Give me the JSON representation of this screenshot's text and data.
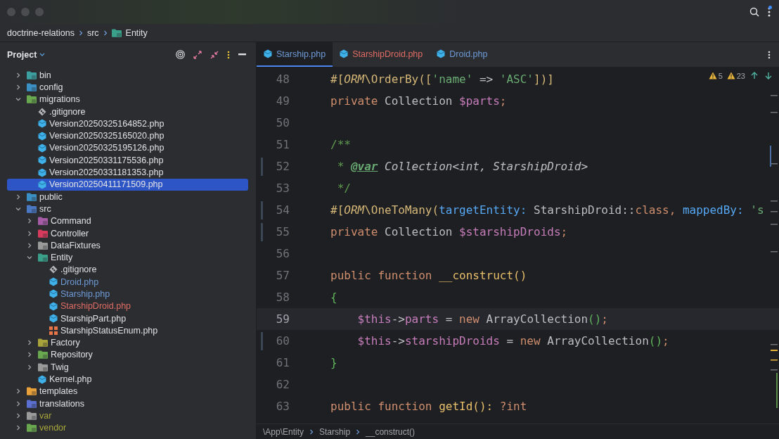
{
  "breadcrumbs": [
    {
      "label": "doctrine-relations",
      "kind": "text"
    },
    {
      "label": "src",
      "kind": "text"
    },
    {
      "label": "Entity",
      "kind": "folder"
    }
  ],
  "project_panel": {
    "title": "Project",
    "tree": [
      {
        "label": "bin",
        "kind": "folder",
        "color": "#3d9ea0",
        "expanded": false,
        "selected": false
      },
      {
        "label": "config",
        "kind": "folder",
        "color": "#3a8fc4",
        "expanded": false,
        "selected": false
      },
      {
        "label": "migrations",
        "kind": "folder",
        "color": "#6aa84f",
        "expanded": true,
        "selected": false,
        "children": [
          {
            "label": ".gitignore",
            "kind": "gitignore",
            "selected": false
          },
          {
            "label": "Version20250325164852.php",
            "kind": "php",
            "selected": false
          },
          {
            "label": "Version20250325165020.php",
            "kind": "php",
            "selected": false
          },
          {
            "label": "Version20250325195126.php",
            "kind": "php",
            "selected": false
          },
          {
            "label": "Version20250331175536.php",
            "kind": "php",
            "selected": false
          },
          {
            "label": "Version20250331181353.php",
            "kind": "php",
            "selected": false
          },
          {
            "label": "Version20250411171509.php",
            "kind": "php",
            "selected": true
          }
        ]
      },
      {
        "label": "public",
        "kind": "folder",
        "color": "#3a8fc4",
        "expanded": false,
        "selected": false
      },
      {
        "label": "src",
        "kind": "folder",
        "color": "#4a78c2",
        "expanded": true,
        "selected": false,
        "children": [
          {
            "label": "Command",
            "kind": "folder",
            "color": "#a55ba6",
            "expanded": false,
            "selected": false
          },
          {
            "label": "Controller",
            "kind": "folder",
            "color": "#d63a5c",
            "expanded": false,
            "selected": false
          },
          {
            "label": "DataFixtures",
            "kind": "folder",
            "color": "#9a9a9a",
            "expanded": false,
            "selected": false
          },
          {
            "label": "Entity",
            "kind": "folder",
            "color": "#3aa08a",
            "expanded": true,
            "selected": false,
            "children": [
              {
                "label": ".gitignore",
                "kind": "gitignore",
                "selected": false
              },
              {
                "label": "Droid.php",
                "kind": "php",
                "selected": false,
                "modified": true
              },
              {
                "label": "Starship.php",
                "kind": "php",
                "selected": false,
                "modified": true
              },
              {
                "label": "StarshipDroid.php",
                "kind": "php",
                "selected": false,
                "added": true
              },
              {
                "label": "StarshipPart.php",
                "kind": "php",
                "selected": false
              },
              {
                "label": "StarshipStatusEnum.php",
                "kind": "enum",
                "selected": false
              }
            ]
          },
          {
            "label": "Factory",
            "kind": "folder",
            "color": "#a8a23a",
            "expanded": false,
            "selected": false
          },
          {
            "label": "Repository",
            "kind": "folder",
            "color": "#6aa84f",
            "expanded": false,
            "selected": false
          },
          {
            "label": "Twig",
            "kind": "folder",
            "color": "#9a9a9a",
            "expanded": false,
            "selected": false
          },
          {
            "label": "Kernel.php",
            "kind": "php",
            "selected": false
          }
        ]
      },
      {
        "label": "templates",
        "kind": "folder",
        "color": "#e8a03a",
        "expanded": false,
        "selected": false
      },
      {
        "label": "translations",
        "kind": "folder",
        "color": "#5a6fd0",
        "expanded": false,
        "selected": false
      },
      {
        "label": "var",
        "kind": "folder",
        "color": "#9a9a9a",
        "expanded": false,
        "selected": false,
        "ignored": true
      },
      {
        "label": "vendor",
        "kind": "folder",
        "color": "#6aa84f",
        "expanded": false,
        "selected": false,
        "ignored": true
      }
    ]
  },
  "editor": {
    "tabs": [
      {
        "label": "Starship.php",
        "selected": true,
        "modified": true,
        "added": false
      },
      {
        "label": "StarshipDroid.php",
        "selected": false,
        "modified": false,
        "added": true
      },
      {
        "label": "Droid.php",
        "selected": false,
        "modified": true,
        "added": false
      }
    ],
    "inspections": {
      "warnings": "5",
      "weak_warnings": "23"
    },
    "lines": [
      {
        "number": "48",
        "current": false,
        "changed": false,
        "tokens": [
          {
            "text": "#[",
            "kind": "attr"
          },
          {
            "text": "ORM",
            "kind": "attr-italic"
          },
          {
            "text": "\\OrderBy([",
            "kind": "attr"
          },
          {
            "text": "'name'",
            "kind": "str"
          },
          {
            "text": " => ",
            "kind": "plain"
          },
          {
            "text": "'ASC'",
            "kind": "str"
          },
          {
            "text": "])]",
            "kind": "attr"
          }
        ]
      },
      {
        "number": "49",
        "current": false,
        "changed": false,
        "tokens": [
          {
            "text": "private",
            "kind": "kw"
          },
          {
            "text": " Collection ",
            "kind": "plain"
          },
          {
            "text": "$parts",
            "kind": "var"
          },
          {
            "text": ";",
            "kind": "kw"
          }
        ]
      },
      {
        "number": "50",
        "current": false,
        "changed": false
      },
      {
        "number": "51",
        "current": false,
        "changed": false,
        "tokens": [
          {
            "text": "/**",
            "kind": "comment"
          }
        ]
      },
      {
        "number": "52",
        "current": false,
        "changed": true,
        "tokens": [
          {
            "text": " * ",
            "kind": "comment"
          },
          {
            "text": "@var",
            "kind": "doctag"
          },
          {
            "text": " Collection<int, StarshipDroid>",
            "kind": "italic"
          }
        ]
      },
      {
        "number": "53",
        "current": false,
        "changed": false,
        "tokens": [
          {
            "text": " */",
            "kind": "comment"
          }
        ]
      },
      {
        "number": "54",
        "current": false,
        "changed": true,
        "tokens": [
          {
            "text": "#[",
            "kind": "attr"
          },
          {
            "text": "ORM",
            "kind": "attr-italic"
          },
          {
            "text": "\\OneToMany(",
            "kind": "attr"
          },
          {
            "text": "targetEntity:",
            "kind": "named"
          },
          {
            "text": " StarshipDroid::",
            "kind": "plain"
          },
          {
            "text": "class,",
            "kind": "kw"
          },
          {
            "text": " mappedBy:",
            "kind": "named"
          },
          {
            "text": " 's",
            "kind": "str"
          }
        ]
      },
      {
        "number": "55",
        "current": false,
        "changed": true,
        "tokens": [
          {
            "text": "private",
            "kind": "kw"
          },
          {
            "text": " Collection ",
            "kind": "plain"
          },
          {
            "text": "$starshipDroids",
            "kind": "var"
          },
          {
            "text": ";",
            "kind": "kw"
          }
        ]
      },
      {
        "number": "56",
        "current": false,
        "changed": false
      },
      {
        "number": "57",
        "current": false,
        "changed": false,
        "tokens": [
          {
            "text": "public function",
            "kind": "kw"
          },
          {
            "text": " __construct()",
            "kind": "fn"
          }
        ]
      },
      {
        "number": "58",
        "current": false,
        "changed": false,
        "tokens": [
          {
            "text": "{",
            "kind": "paren"
          }
        ]
      },
      {
        "number": "59",
        "current": true,
        "changed": false,
        "tokens": [
          {
            "text": "    $this",
            "kind": "var"
          },
          {
            "text": "->",
            "kind": "plain"
          },
          {
            "text": "parts",
            "kind": "var"
          },
          {
            "text": " = ",
            "kind": "plain"
          },
          {
            "text": "new",
            "kind": "kw"
          },
          {
            "text": " ArrayCollection",
            "kind": "plain"
          },
          {
            "text": "()",
            "kind": "paren"
          },
          {
            "text": ";",
            "kind": "kw"
          }
        ]
      },
      {
        "number": "60",
        "current": false,
        "changed": true,
        "tokens": [
          {
            "text": "    $this",
            "kind": "var"
          },
          {
            "text": "->",
            "kind": "plain"
          },
          {
            "text": "starshipDroids",
            "kind": "var"
          },
          {
            "text": " = ",
            "kind": "plain"
          },
          {
            "text": "new",
            "kind": "kw"
          },
          {
            "text": " ArrayCollection",
            "kind": "plain"
          },
          {
            "text": "()",
            "kind": "paren"
          },
          {
            "text": ";",
            "kind": "kw"
          }
        ]
      },
      {
        "number": "61",
        "current": false,
        "changed": false,
        "tokens": [
          {
            "text": "}",
            "kind": "paren"
          }
        ]
      },
      {
        "number": "62",
        "current": false,
        "changed": false
      },
      {
        "number": "63",
        "current": false,
        "changed": false,
        "tokens": [
          {
            "text": "public function",
            "kind": "kw"
          },
          {
            "text": " getId",
            "kind": "fn"
          },
          {
            "text": "(): ",
            "kind": "fn"
          },
          {
            "text": "?int",
            "kind": "kw"
          }
        ]
      }
    ],
    "breadcrumbs": [
      "\\App\\Entity",
      "Starship",
      "__construct()"
    ]
  }
}
